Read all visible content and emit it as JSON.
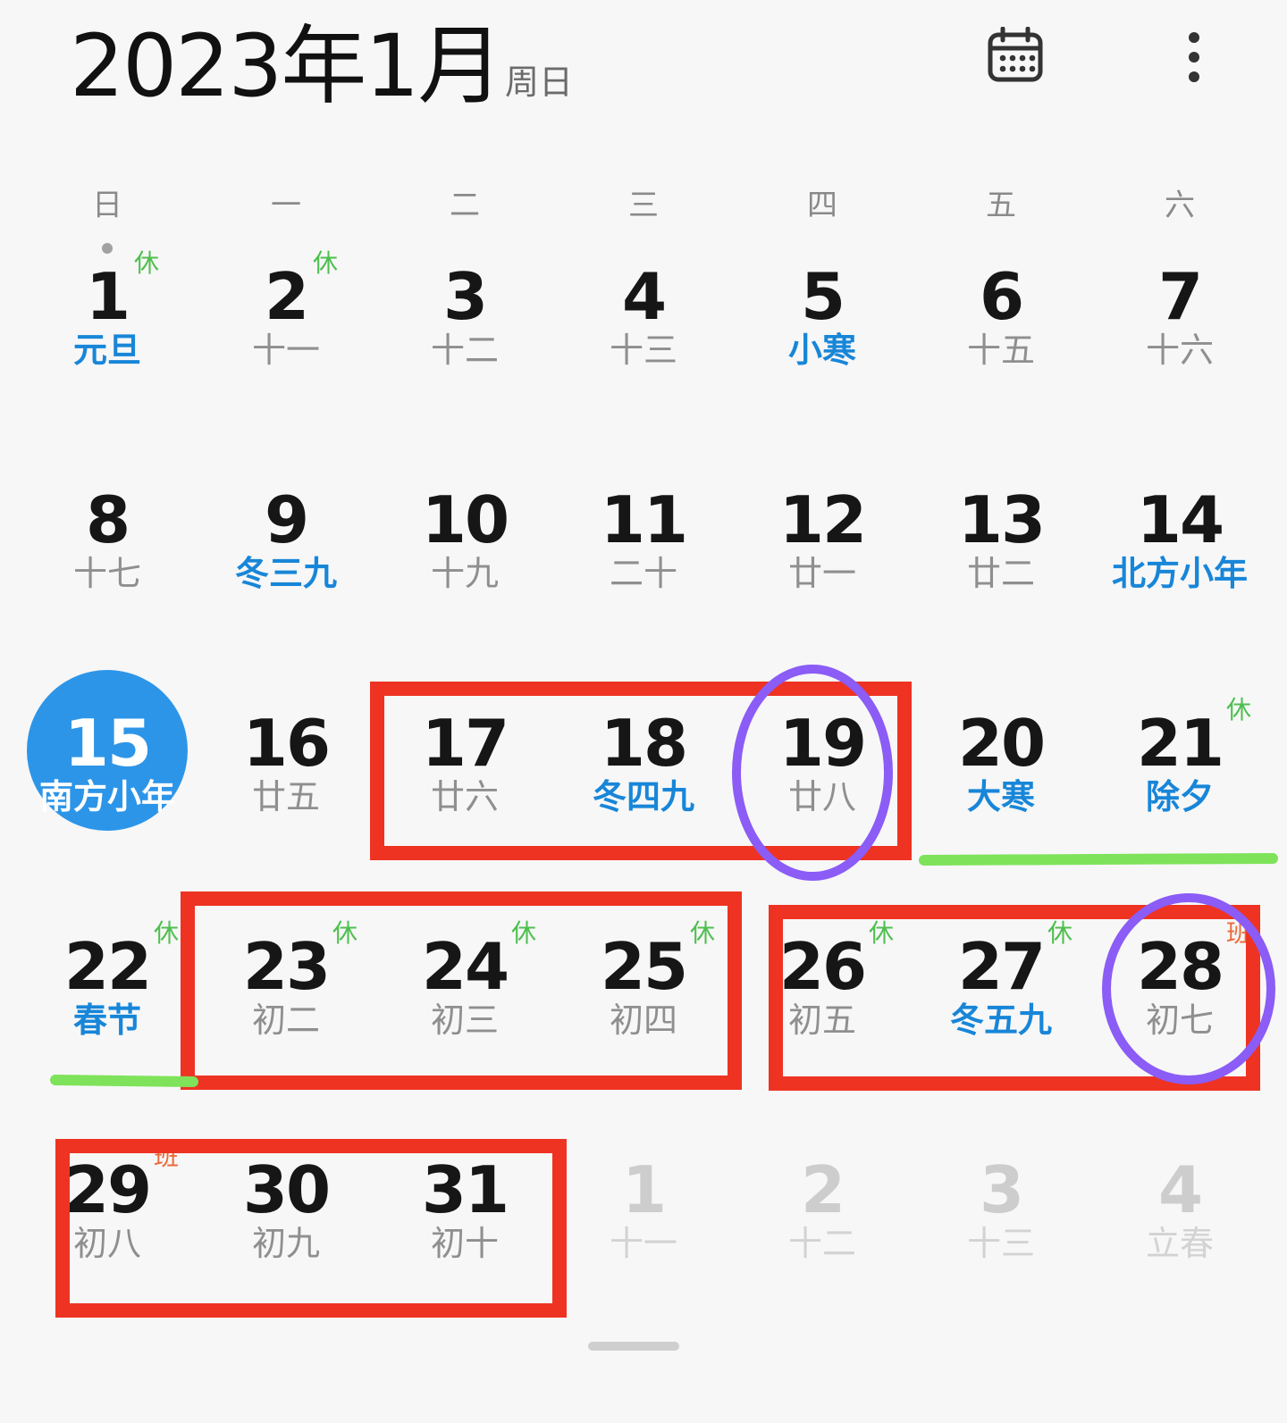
{
  "header": {
    "title": "2023年1月",
    "subtitle": "周日",
    "calendar_icon": "calendar-icon",
    "more_icon": "more-vertical-icon"
  },
  "weekdays": [
    "日",
    "一",
    "二",
    "三",
    "四",
    "五",
    "六"
  ],
  "rows": [
    [
      {
        "day": "1",
        "lunar": "元旦",
        "special": true,
        "badge": "休"
      },
      {
        "day": "2",
        "lunar": "十一",
        "badge": "休"
      },
      {
        "day": "3",
        "lunar": "十二"
      },
      {
        "day": "4",
        "lunar": "十三"
      },
      {
        "day": "5",
        "lunar": "小寒",
        "special": true
      },
      {
        "day": "6",
        "lunar": "十五"
      },
      {
        "day": "7",
        "lunar": "十六"
      }
    ],
    [
      {
        "day": "8",
        "lunar": "十七"
      },
      {
        "day": "9",
        "lunar": "冬三九",
        "special": true
      },
      {
        "day": "10",
        "lunar": "十九"
      },
      {
        "day": "11",
        "lunar": "二十"
      },
      {
        "day": "12",
        "lunar": "廿一"
      },
      {
        "day": "13",
        "lunar": "廿二"
      },
      {
        "day": "14",
        "lunar": "北方小年",
        "special": true
      }
    ],
    [
      {
        "day": "15",
        "lunar": "南方小年",
        "special": true,
        "today": true
      },
      {
        "day": "16",
        "lunar": "廿五"
      },
      {
        "day": "17",
        "lunar": "廿六"
      },
      {
        "day": "18",
        "lunar": "冬四九",
        "special": true
      },
      {
        "day": "19",
        "lunar": "廿八"
      },
      {
        "day": "20",
        "lunar": "大寒",
        "special": true
      },
      {
        "day": "21",
        "lunar": "除夕",
        "special": true,
        "badge": "休"
      }
    ],
    [
      {
        "day": "22",
        "lunar": "春节",
        "special": true,
        "badge": "休"
      },
      {
        "day": "23",
        "lunar": "初二",
        "badge": "休"
      },
      {
        "day": "24",
        "lunar": "初三",
        "badge": "休"
      },
      {
        "day": "25",
        "lunar": "初四",
        "badge": "休"
      },
      {
        "day": "26",
        "lunar": "初五",
        "badge": "休"
      },
      {
        "day": "27",
        "lunar": "冬五九",
        "special": true,
        "badge": "休"
      },
      {
        "day": "28",
        "lunar": "初七",
        "badge": "班",
        "badge_type": "work"
      }
    ],
    [
      {
        "day": "29",
        "lunar": "初八",
        "badge": "班",
        "badge_type": "work"
      },
      {
        "day": "30",
        "lunar": "初九"
      },
      {
        "day": "31",
        "lunar": "初十"
      },
      {
        "day": "1",
        "lunar": "十一",
        "other_month": true
      },
      {
        "day": "2",
        "lunar": "十二",
        "other_month": true
      },
      {
        "day": "3",
        "lunar": "十三",
        "other_month": true
      },
      {
        "day": "4",
        "lunar": "立春",
        "other_month": true
      }
    ]
  ],
  "colors": {
    "background": "#f7f7f7",
    "today_fill": "#2d95e8",
    "festival_text": "#1886d8",
    "holiday_badge": "#4fbf4f",
    "work_badge": "#ec6a3a",
    "annotation_red": "#ee3322",
    "annotation_purple": "#8b5cf6",
    "annotation_green": "#7ee35a"
  }
}
